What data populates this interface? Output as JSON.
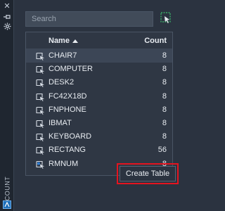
{
  "palette": {
    "title": "COUNT",
    "close_icon": "close-icon",
    "pin_icon": "pin-icon",
    "settings_icon": "gear-icon",
    "app_icon": "autocad-app-icon"
  },
  "search": {
    "value": "",
    "placeholder": "Search"
  },
  "select_objects_icon": "select-objects-icon",
  "table": {
    "columns": {
      "name": "Name",
      "count": "Count"
    },
    "sort": {
      "column": "name",
      "direction": "ascending"
    },
    "rows": [
      {
        "name": "CHAIR7",
        "count": "8",
        "icon": "block-icon",
        "selected": true
      },
      {
        "name": "COMPUTER",
        "count": "8",
        "icon": "block-icon",
        "selected": false
      },
      {
        "name": "DESK2",
        "count": "8",
        "icon": "block-icon",
        "selected": false
      },
      {
        "name": "FC42X18D",
        "count": "8",
        "icon": "block-icon",
        "selected": false
      },
      {
        "name": "FNPHONE",
        "count": "8",
        "icon": "block-icon",
        "selected": false
      },
      {
        "name": "IBMAT",
        "count": "8",
        "icon": "block-icon",
        "selected": false
      },
      {
        "name": "KEYBOARD",
        "count": "8",
        "icon": "block-icon",
        "selected": false
      },
      {
        "name": "RECTANG",
        "count": "56",
        "icon": "block-icon",
        "selected": false
      },
      {
        "name": "RMNUM",
        "count": "8",
        "icon": "block-attribute-icon",
        "selected": false
      }
    ]
  },
  "create_table_label": "Create Table",
  "colors": {
    "background": "#2b3340",
    "panel": "#2f3744",
    "highlight_outline": "#e4141f",
    "selected_row": "#3c4656"
  }
}
